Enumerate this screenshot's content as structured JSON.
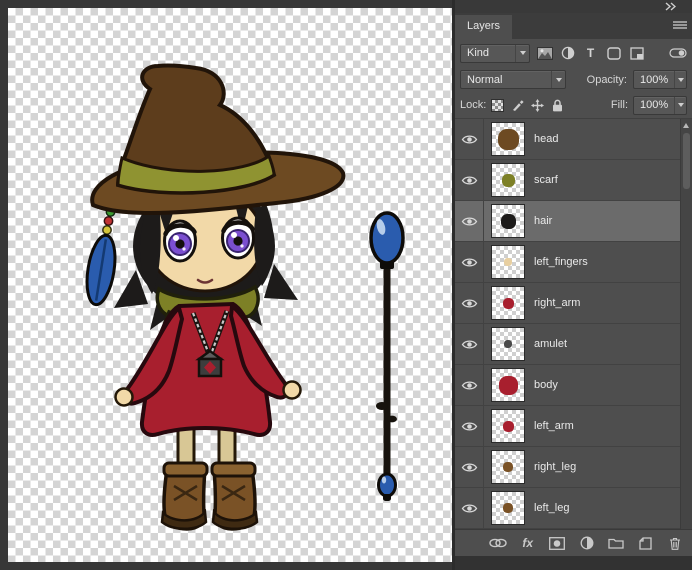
{
  "panel": {
    "tab_label": "Layers",
    "filter_row": {
      "kind_label": "Kind",
      "type_glyph": "T",
      "filter_types": [
        "pixel",
        "adjustment",
        "type",
        "shape",
        "smart-object"
      ]
    },
    "blend_row": {
      "blend_mode": "Normal",
      "opacity_label": "Opacity:",
      "opacity_value": "100%"
    },
    "lock_row": {
      "lock_label": "Lock:",
      "fill_label": "Fill:",
      "fill_value": "100%",
      "lock_types": [
        "lock-transparency",
        "lock-pixels",
        "lock-position",
        "lock-all"
      ]
    },
    "fx_label": "fx",
    "footer_tools": [
      "link-layers",
      "layer-styles",
      "add-layer-mask",
      "new-adjustment-layer",
      "new-group",
      "new-layer",
      "delete-layer"
    ],
    "layers": [
      {
        "name": "head",
        "visible": true,
        "selected": false,
        "thumb_color": "#6d4a22",
        "thumb_size": "21px"
      },
      {
        "name": "scarf",
        "visible": true,
        "selected": false,
        "thumb_color": "#7d8026",
        "thumb_size": "13px"
      },
      {
        "name": "hair",
        "visible": true,
        "selected": true,
        "thumb_color": "#1d1b1a",
        "thumb_size": "15px"
      },
      {
        "name": "left_fingers",
        "visible": true,
        "selected": false,
        "thumb_color": "#e8cfa0",
        "thumb_size": "8px"
      },
      {
        "name": "right_arm",
        "visible": true,
        "selected": false,
        "thumb_color": "#a81f2e",
        "thumb_size": "11px"
      },
      {
        "name": "amulet",
        "visible": true,
        "selected": false,
        "thumb_color": "#4a4a4a",
        "thumb_size": "8px"
      },
      {
        "name": "body",
        "visible": true,
        "selected": false,
        "thumb_color": "#a81f2e",
        "thumb_size": "19px"
      },
      {
        "name": "left_arm",
        "visible": true,
        "selected": false,
        "thumb_color": "#a81f2e",
        "thumb_size": "11px"
      },
      {
        "name": "right_leg",
        "visible": true,
        "selected": false,
        "thumb_color": "#7a5226",
        "thumb_size": "10px"
      },
      {
        "name": "left_leg",
        "visible": true,
        "selected": false,
        "thumb_color": "#7a5226",
        "thumb_size": "10px"
      }
    ]
  },
  "canvas": {
    "subject": "Chibi witch character with floppy hat, scarf, amulet, boots and a blue-orb staff on transparent background",
    "colors": {
      "outline": "#211409",
      "hat_brim": "#6d4a22",
      "hat_crown": "#5d3d1c",
      "hat_band": "#8f9331",
      "hair": "#1d1b1a",
      "skin": "#f2d9a8",
      "eyes": "#7b4fd0",
      "eye_ring": "#3a2470",
      "dress": "#a81f2e",
      "scarf": "#7d8026",
      "socks": "#d8c795",
      "boots": "#7a5226",
      "boots_cuff": "#8a6230",
      "sole": "#3f2a12",
      "staff": "#17130d",
      "staff_orb": "#2a5cae",
      "bead_green": "#3a9a30",
      "bead_red": "#c23434",
      "bead_yellow": "#d4c53a",
      "chain": "#c9c9c9",
      "pendant": "#3d3d3d",
      "checker_light": "#ffffff",
      "checker_dark": "#d4d4d4"
    }
  }
}
